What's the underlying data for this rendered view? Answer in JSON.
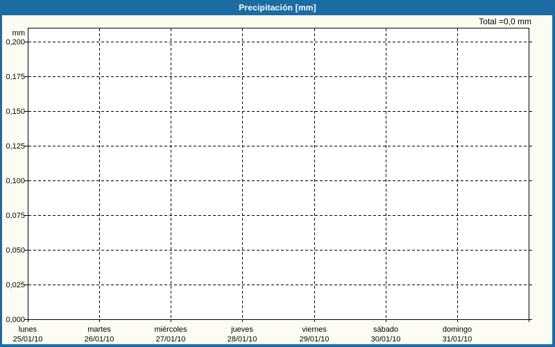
{
  "window": {
    "title": "Precipitación [mm]",
    "total_label": "Total =0,0 mm"
  },
  "colors": {
    "titlebar": "#1C6CA4",
    "title_text": "#FFFFFF",
    "content_bg": "#FCFCF2",
    "plot_bg": "#FFFFFF",
    "grid": "#000000",
    "text": "#000000"
  },
  "chart_data": {
    "type": "line",
    "title": "Precipitación [mm]",
    "ylabel": "mm",
    "total_text": "Total =0,0 mm",
    "total_mm": 0.0,
    "ylim": [
      0,
      0.21
    ],
    "grid": "dashed",
    "legend": "none",
    "y_tick_labels": [
      "0,000",
      "0,025",
      "0,050",
      "0,075",
      "0,100",
      "0,125",
      "0,150",
      "0,175",
      "0,200"
    ],
    "y_tick_values": [
      0,
      0.025,
      0.05,
      0.075,
      0.1,
      0.125,
      0.15,
      0.175,
      0.2
    ],
    "x_categories": [
      {
        "day": "lunes",
        "date": "25/01/10"
      },
      {
        "day": "martes",
        "date": "26/01/10"
      },
      {
        "day": "miércoles",
        "date": "27/01/10"
      },
      {
        "day": "jueves",
        "date": "28/01/10"
      },
      {
        "day": "viernes",
        "date": "29/01/10"
      },
      {
        "day": "sábado",
        "date": "30/01/10"
      },
      {
        "day": "domingo",
        "date": "31/01/10"
      }
    ],
    "series": [
      {
        "name": "Precipitación",
        "unit": "mm",
        "values": [
          0,
          0,
          0,
          0,
          0,
          0,
          0
        ]
      }
    ]
  }
}
